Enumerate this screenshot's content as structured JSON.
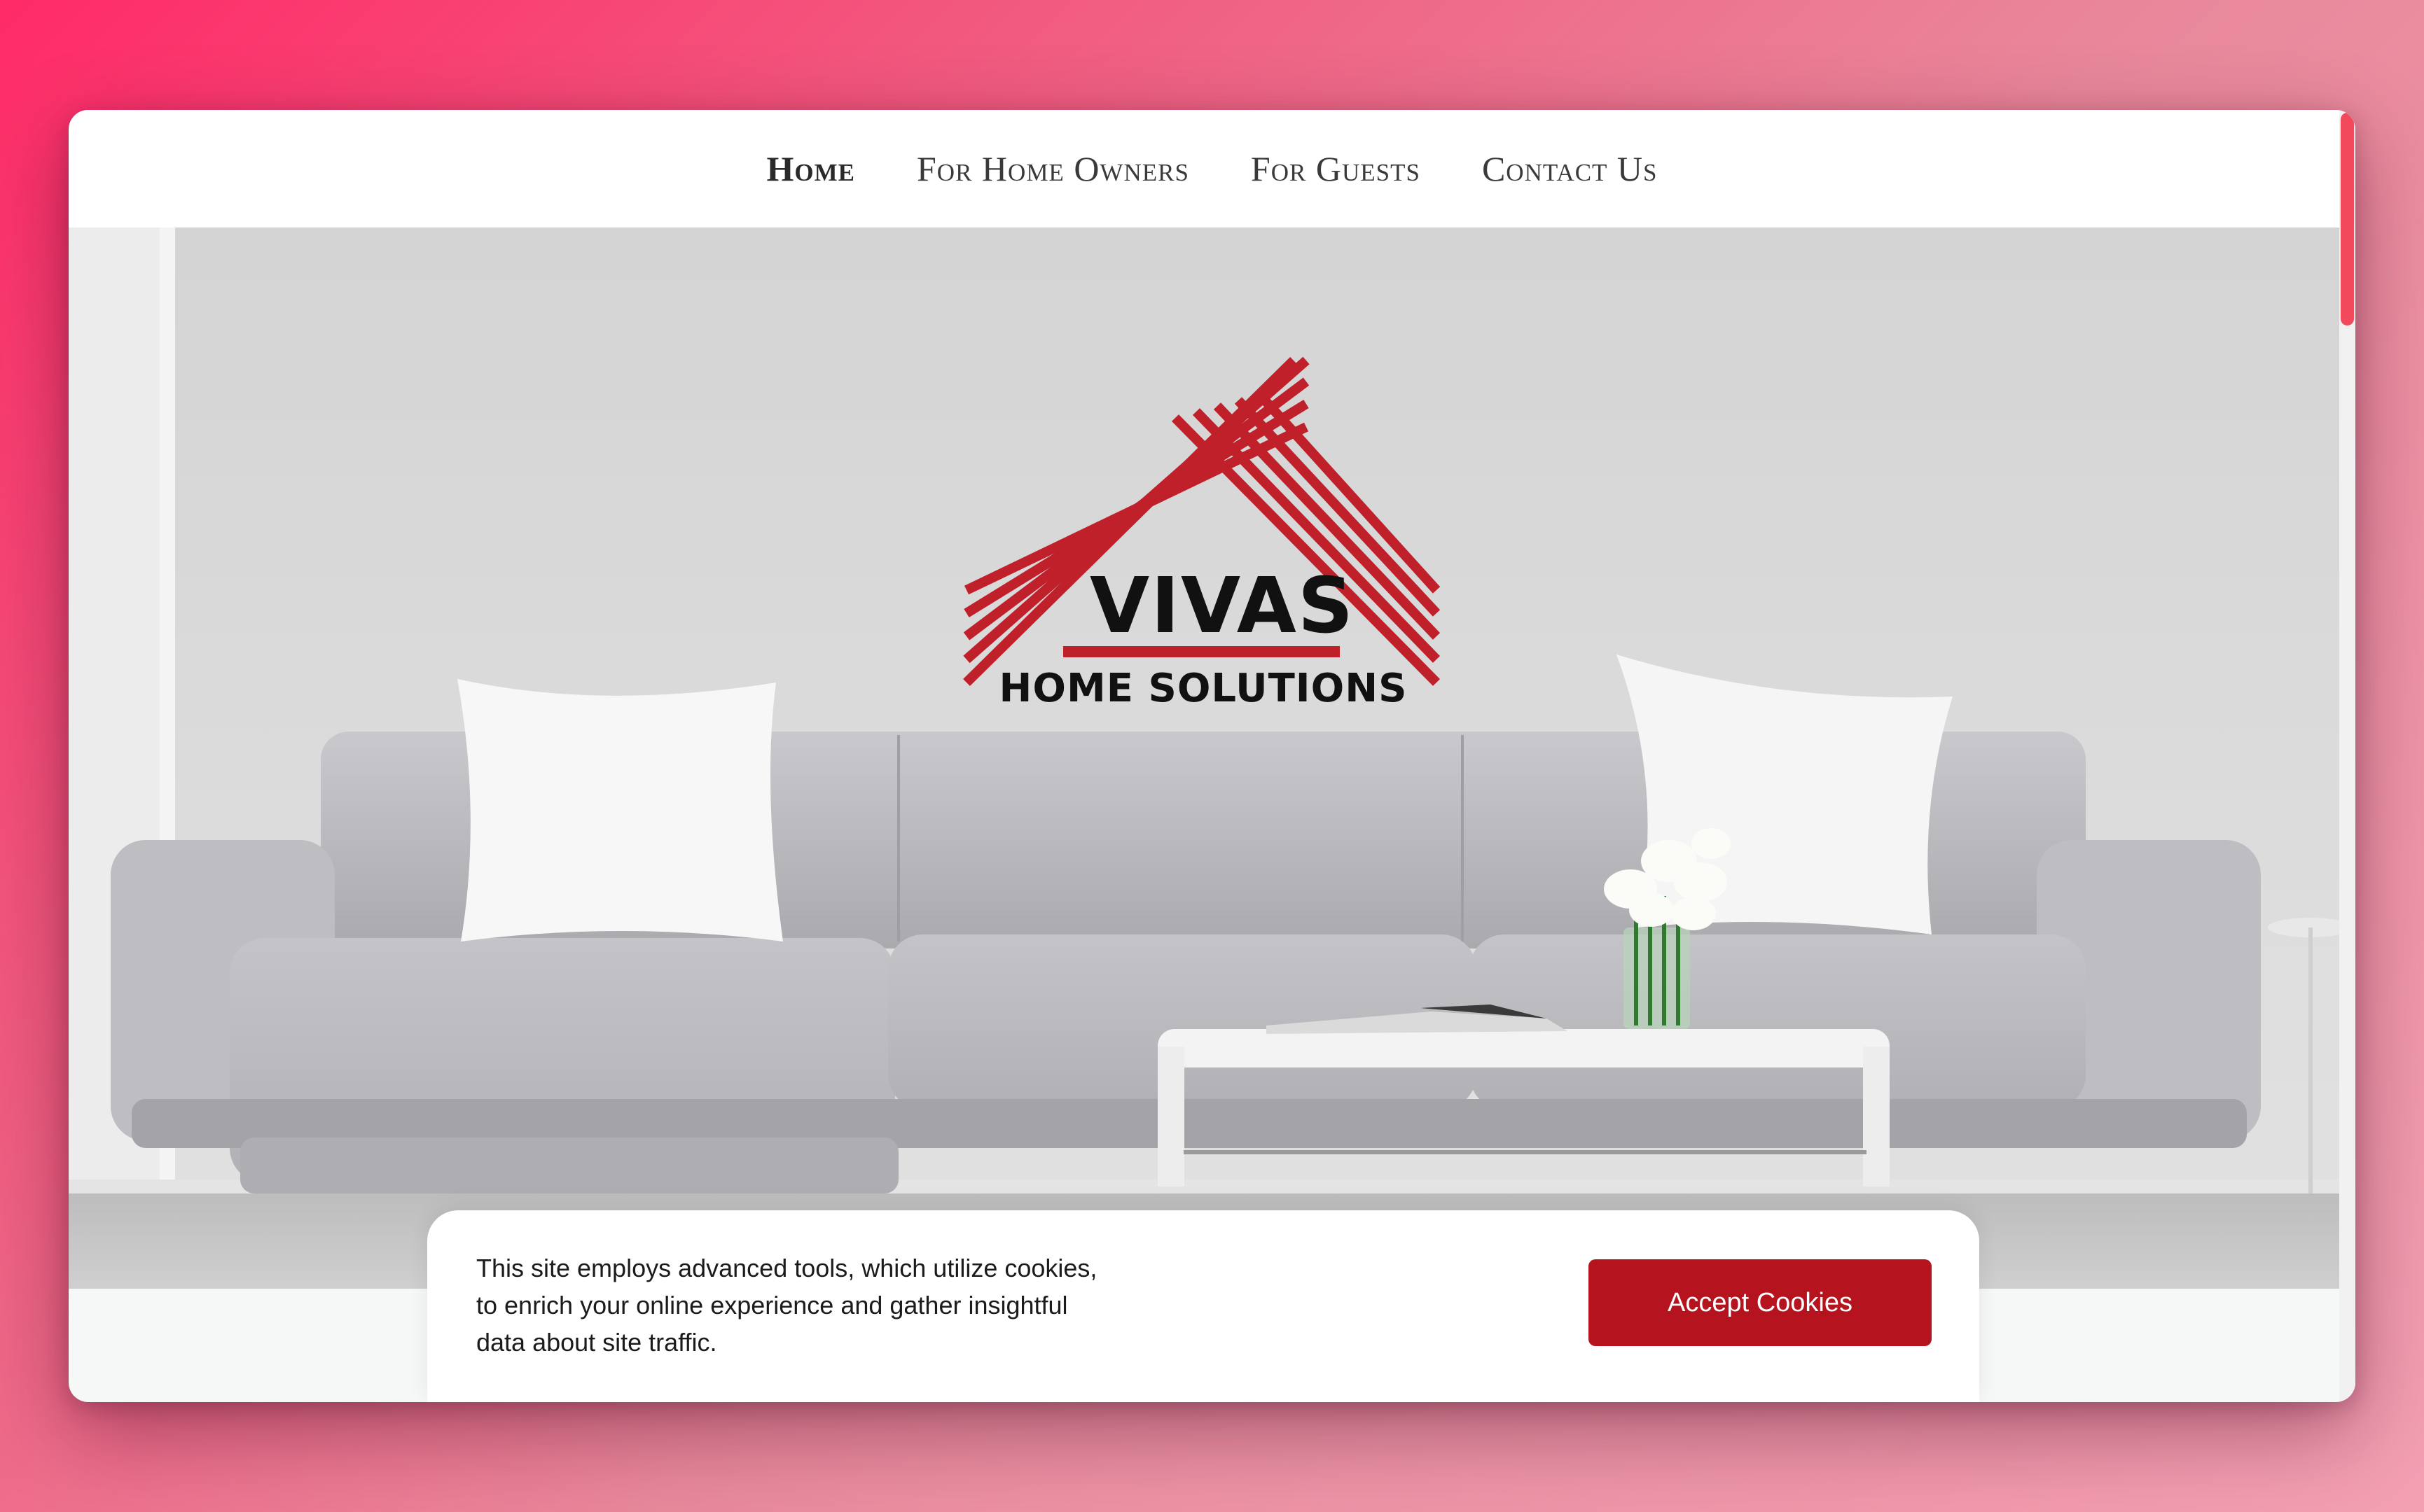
{
  "nav": {
    "items": [
      {
        "label": "Home",
        "active": true
      },
      {
        "label": "For Home Owners",
        "active": false
      },
      {
        "label": "For Guests",
        "active": false
      },
      {
        "label": "Contact Us",
        "active": false
      }
    ]
  },
  "logo": {
    "brand": "VIVAS",
    "tagline": "HOME SOLUTIONS",
    "accent_color": "#c0202a"
  },
  "cookie": {
    "text": "This site employs advanced tools, which utilize cookies, to enrich your online experience and gather insightful data about site traffic.",
    "button_label": "Accept Cookies",
    "button_color": "#b5141e"
  },
  "scrollbar": {
    "thumb_color": "#f04a5c"
  }
}
